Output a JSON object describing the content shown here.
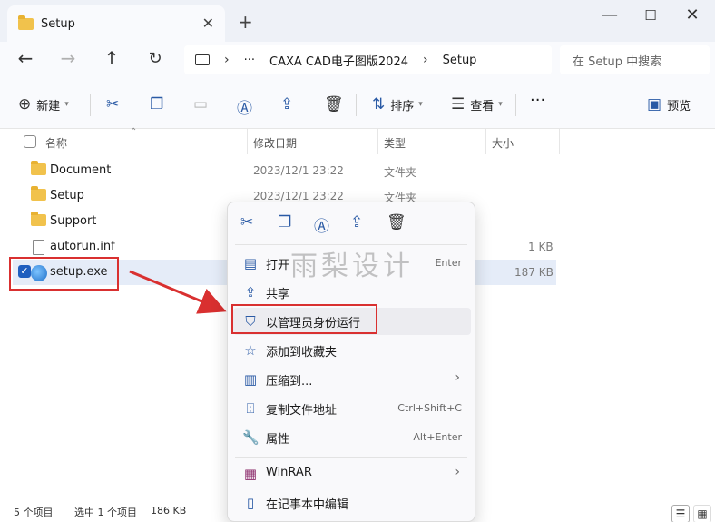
{
  "window": {
    "tab_title": "Setup",
    "new_tab": "+",
    "close_tab": "✕",
    "min": "—",
    "max": "☐",
    "close": "✕"
  },
  "nav": {
    "back": "←",
    "forward": "→",
    "up": "↑",
    "refresh": "↻",
    "more": "···",
    "crumbs": [
      "CAXA CAD电子图版2024",
      "Setup"
    ],
    "separator": "›",
    "search_placeholder": "在 Setup 中搜索"
  },
  "toolbar": {
    "new_label": "新建",
    "sort_label": "排序",
    "view_label": "查看",
    "more": "···",
    "preview_label": "预览"
  },
  "columns": {
    "name": "名称",
    "modified": "修改日期",
    "type": "类型",
    "size": "大小"
  },
  "files": [
    {
      "name": "Document",
      "modified": "2023/12/1 23:22",
      "type": "文件夹",
      "size": ""
    },
    {
      "name": "Setup",
      "modified": "2023/12/1 23:22",
      "type": "文件夹",
      "size": ""
    },
    {
      "name": "Support",
      "modified": "",
      "type": "",
      "size": ""
    },
    {
      "name": "autorun.inf",
      "modified": "",
      "type": "",
      "size": "1 KB"
    },
    {
      "name": "setup.exe",
      "modified": "",
      "type": "",
      "size": "187 KB"
    }
  ],
  "context_menu": {
    "items": [
      {
        "label": "打开",
        "shortcut": "Enter"
      },
      {
        "label": "共享",
        "shortcut": ""
      },
      {
        "label": "以管理员身份运行",
        "shortcut": ""
      },
      {
        "label": "添加到收藏夹",
        "shortcut": ""
      },
      {
        "label": "压缩到...",
        "shortcut": ""
      },
      {
        "label": "复制文件地址",
        "shortcut": "Ctrl+Shift+C"
      },
      {
        "label": "属性",
        "shortcut": "Alt+Enter"
      },
      {
        "label": "WinRAR",
        "shortcut": ""
      },
      {
        "label": "在记事本中编辑",
        "shortcut": ""
      }
    ],
    "chevron": "›"
  },
  "watermark": "雨梨设计",
  "status": {
    "count": "5 个项目",
    "selected": "选中 1 个项目",
    "size": "186 KB"
  },
  "colors": {
    "accent": "#2a5aa5",
    "highlight_red": "#d93030",
    "selection": "#e5ecf8"
  }
}
